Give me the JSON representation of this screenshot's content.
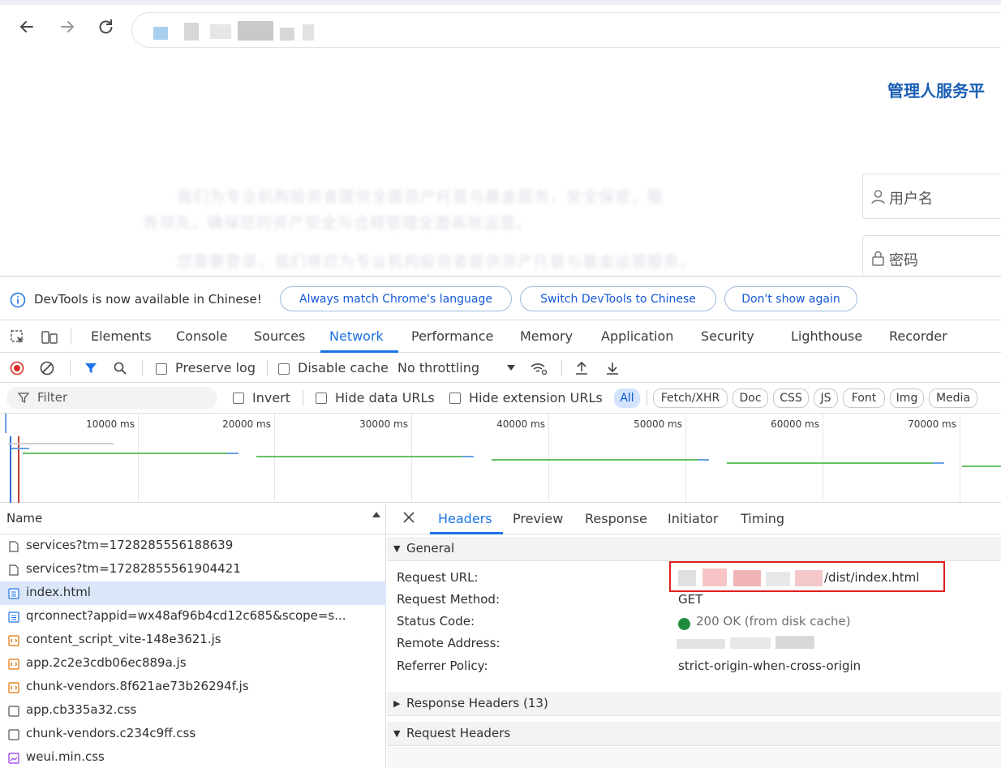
{
  "browser": {
    "nav": {
      "back": "back-icon",
      "forward": "forward-icon",
      "reload": "reload-icon"
    }
  },
  "page": {
    "site_title": "管理人服务平",
    "ghost_lines": [
      "我们为专业机构投资者提供全面资产托管与基金服务，安全保密，服",
      "务领先，确保您的资产安全与合规管理全面高效运营。",
      "您需要登录，我们将您为专业机构投资者提供资产托管与基金运营服务。"
    ],
    "username_placeholder": "用户名",
    "password_placeholder": "密码"
  },
  "devtools": {
    "info": {
      "text": "DevTools is now available in Chinese!",
      "btn_match": "Always match Chrome's language",
      "btn_switch": "Switch DevTools to Chinese",
      "btn_dont": "Don't show again"
    },
    "tabs": [
      "Elements",
      "Console",
      "Sources",
      "Network",
      "Performance",
      "Memory",
      "Application",
      "Security",
      "Lighthouse",
      "Recorder"
    ],
    "active_tab": "Network",
    "toolbar": {
      "preserve_log": "Preserve log",
      "disable_cache": "Disable cache",
      "throttling": "No throttling"
    },
    "filter": {
      "placeholder": "Filter",
      "invert": "Invert",
      "hide_data": "Hide data URLs",
      "hide_ext": "Hide extension URLs",
      "chips": [
        "All",
        "Fetch/XHR",
        "Doc",
        "CSS",
        "JS",
        "Font",
        "Img",
        "Media"
      ]
    },
    "timeline_ticks": [
      "10000 ms",
      "20000 ms",
      "30000 ms",
      "40000 ms",
      "50000 ms",
      "60000 ms",
      "70000 ms"
    ],
    "requests": {
      "header": "Name",
      "items": [
        {
          "name": "services?tm=1728285556188639",
          "type": "doc"
        },
        {
          "name": "services?tm=17282855561904421",
          "type": "doc"
        },
        {
          "name": "index.html",
          "type": "html"
        },
        {
          "name": "qrconnect?appid=wx48af96b4cd12c685&scope=s...",
          "type": "html"
        },
        {
          "name": "content_script_vite-148e3621.js",
          "type": "js"
        },
        {
          "name": "app.2c2e3cdb06ec889a.js",
          "type": "js"
        },
        {
          "name": "chunk-vendors.8f621ae73b26294f.js",
          "type": "js"
        },
        {
          "name": "app.cb335a32.css",
          "type": "css"
        },
        {
          "name": "chunk-vendors.c234c9ff.css",
          "type": "css"
        },
        {
          "name": "weui.min.css",
          "type": "img"
        }
      ],
      "selected": "index.html"
    },
    "detail": {
      "tabs": [
        "Headers",
        "Preview",
        "Response",
        "Initiator",
        "Timing"
      ],
      "active": "Headers",
      "general_title": "General",
      "general": [
        {
          "key": "Request URL:",
          "value": "/dist/index.html"
        },
        {
          "key": "Request Method:",
          "value": "GET"
        },
        {
          "key": "Status Code:",
          "value": "200 OK (from disk cache)"
        },
        {
          "key": "Remote Address:",
          "value": ""
        },
        {
          "key": "Referrer Policy:",
          "value": "strict-origin-when-cross-origin"
        }
      ],
      "response_headers": "Response Headers (13)",
      "request_headers": "Request Headers"
    },
    "colors": {
      "accent": "#1a73e8",
      "highlight_box": "#e02020",
      "status_ok": "#1e8e3e"
    }
  }
}
